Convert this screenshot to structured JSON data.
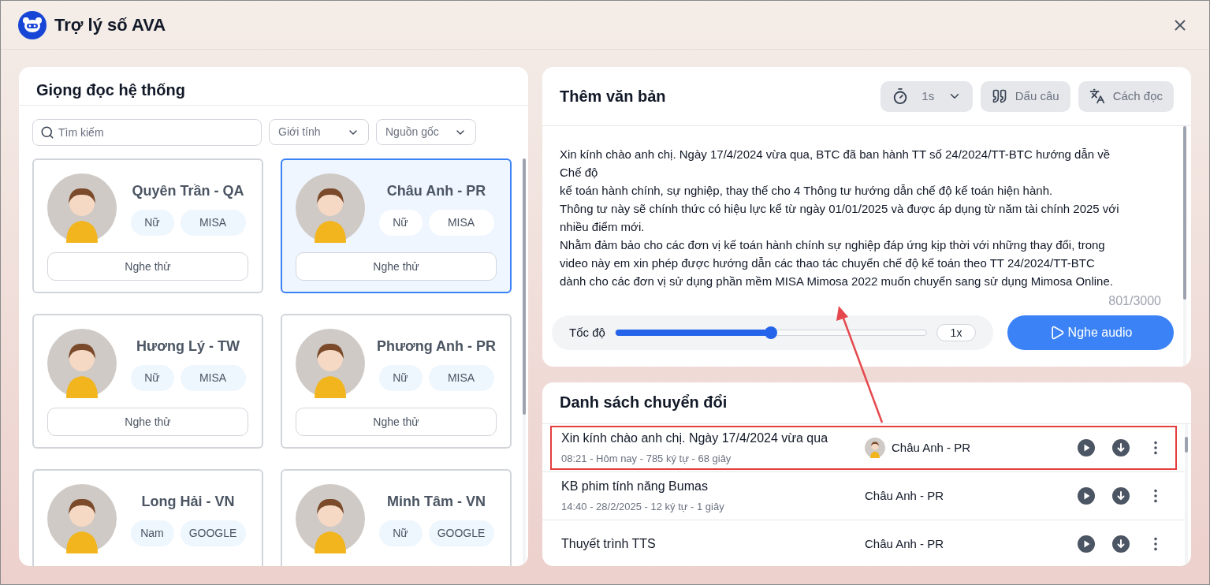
{
  "window": {
    "title": "Trợ lý số AVA"
  },
  "voices_panel": {
    "title": "Giọng đọc hệ thống",
    "search": {
      "placeholder": "Tìm kiếm"
    },
    "filters": [
      {
        "label": "Giới tính"
      },
      {
        "label": "Nguồn gốc"
      }
    ],
    "voices": [
      {
        "name": "Quyên Trần - QA",
        "tags": [
          "Nữ",
          "MISA"
        ],
        "button": "Nghe thử",
        "selected": false
      },
      {
        "name": "Châu Anh - PR",
        "tags": [
          "Nữ",
          "MISA"
        ],
        "button": "Nghe thử",
        "selected": true
      },
      {
        "name": "Hương Lý - TW",
        "tags": [
          "Nữ",
          "MISA"
        ],
        "button": "Nghe thử",
        "selected": false
      },
      {
        "name": "Phương Anh - PR",
        "tags": [
          "Nữ",
          "MISA"
        ],
        "button": "Nghe thử",
        "selected": false
      },
      {
        "name": "Long Hải - VN",
        "tags": [
          "Nam",
          "GOOGLE"
        ],
        "selected": false
      },
      {
        "name": "Minh Tâm - VN",
        "tags": [
          "Nữ",
          "GOOGLE"
        ],
        "selected": false
      }
    ]
  },
  "editor": {
    "title": "Thêm văn bản",
    "tools": [
      {
        "kind": "pause",
        "label": "1s"
      },
      {
        "kind": "punctuation",
        "label": "Dấu câu"
      },
      {
        "kind": "pronunciation",
        "label": "Cách đọc"
      }
    ],
    "text_lines": [
      "Xin kính chào anh chị. Ngày 17/4/2024 vừa qua, BTC đã ban hành TT số 24/2024/TT-BTC hướng dẫn về",
      "Chế độ",
      "kế toán hành chính, sự nghiệp, thay thế cho 4 Thông tư hướng dẫn chế độ kế toán hiện hành.",
      "Thông tư này sẽ chính thức có hiệu lực kể từ ngày 01/01/2025 và được áp dụng từ năm tài chính 2025 với",
      "nhiều điểm mới.",
      "Nhằm đảm bảo cho các đơn vị kế toán hành chính sự nghiệp đáp ứng kịp thời với những thay đổi, trong",
      "video này em xin phép được hướng dẫn các thao tác chuyển chế độ kế toán theo TT 24/2024/TT-BTC",
      "dành cho các đơn vị sử dụng phần mềm MISA Mimosa 2022 muốn chuyển sang sử dụng Mimosa Online."
    ],
    "counter": "801/3000",
    "speed": {
      "label": "Tốc độ",
      "level": 0.5,
      "reading": "1x"
    },
    "play_button": "Nghe audio"
  },
  "conversions": {
    "title": "Danh sách chuyển đổi",
    "items": [
      {
        "title": "Xin kính chào anh chị. Ngày 17/4/2024 vừa qua",
        "meta": "08:21 - Hôm nay - 785 ký tự - 68 giây",
        "voice": "Châu Anh - PR",
        "has_avatar": true,
        "highlighted": true
      },
      {
        "title": "KB phim tính năng Bumas",
        "meta": "14:40 - 28/2/2025 - 12 ký tự - 1 giây",
        "voice": "Châu Anh - PR",
        "has_avatar": false,
        "highlighted": false
      },
      {
        "title": "Thuyết trình TTS",
        "voice": "Châu Anh - PR",
        "has_avatar": false,
        "highlighted": false
      }
    ]
  }
}
